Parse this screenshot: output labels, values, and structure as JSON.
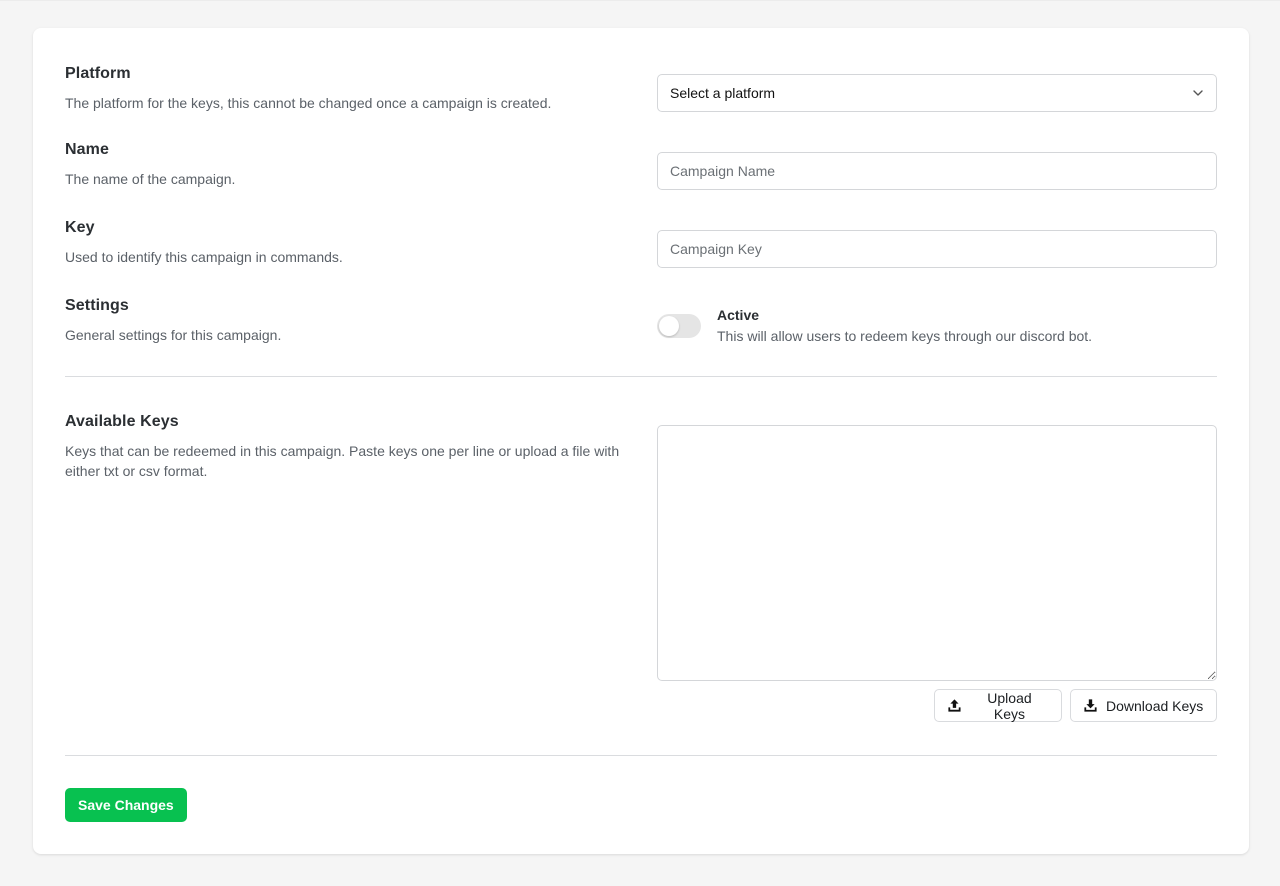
{
  "fields": {
    "platform": {
      "title": "Platform",
      "description": "The platform for the keys, this cannot be changed once a campaign is created.",
      "selected": "Select a platform"
    },
    "name": {
      "title": "Name",
      "description": "The name of the campaign.",
      "placeholder": "Campaign Name",
      "value": ""
    },
    "key": {
      "title": "Key",
      "description": "Used to identify this campaign in commands.",
      "placeholder": "Campaign Key",
      "value": ""
    },
    "settings": {
      "title": "Settings",
      "description": "General settings for this campaign.",
      "toggle_label": "Active",
      "toggle_description": "This will allow users to redeem keys through our discord bot.",
      "toggle_on": false
    },
    "available_keys": {
      "title": "Available Keys",
      "description": "Keys that can be redeemed in this campaign. Paste keys one per line or upload a file with either txt or csv format.",
      "value": ""
    }
  },
  "buttons": {
    "upload": "Upload Keys",
    "download": "Download Keys",
    "save": "Save Changes"
  },
  "colors": {
    "accent": "#08c150",
    "toggle_off": "#e5e5e5",
    "background": "#f5f5f5"
  },
  "icons": {
    "select": "chevron-down-icon",
    "upload": "upload-icon",
    "download": "download-icon"
  }
}
